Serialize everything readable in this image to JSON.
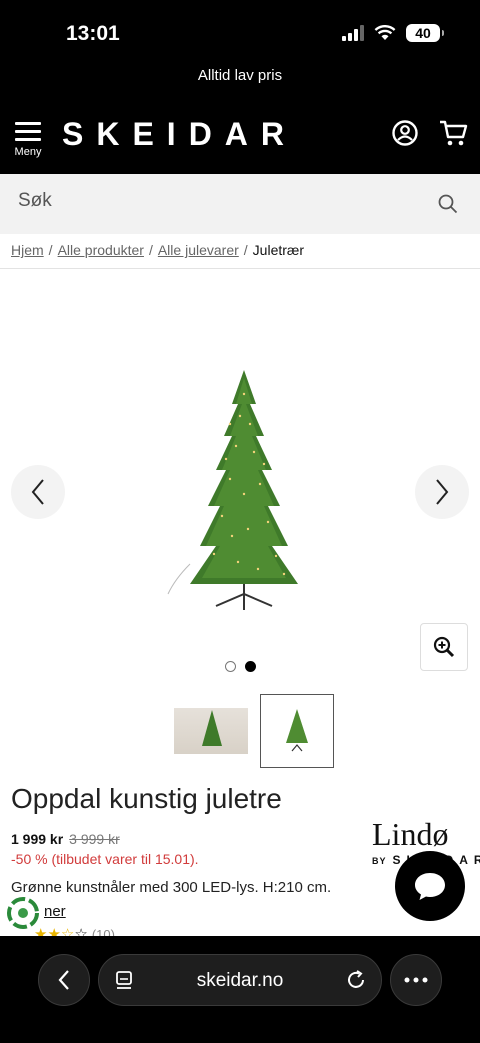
{
  "status": {
    "time": "13:01",
    "battery": "40"
  },
  "promo": {
    "text": "Alltid lav pris"
  },
  "header": {
    "logo": "SKEIDAR",
    "menu_label": "Meny"
  },
  "search": {
    "placeholder": "Søk"
  },
  "breadcrumb": {
    "items": [
      "Hjem",
      "Alle produkter",
      "Alle julevarer"
    ],
    "current": "Juletrær"
  },
  "gallery": {
    "slide_count": 2,
    "active_slide": 2
  },
  "product": {
    "title": "Oppdal kunstig juletre",
    "price_now": "1 999 kr",
    "price_old": "3 999 kr",
    "discount": "-50 % (tilbudet varer til 15.01).",
    "description": "Grønne kunstnåler med 300 LED-lys. H:210 cm.",
    "reco_link": "ner",
    "rating_stars": 3,
    "rating_count": "(10)"
  },
  "brand": {
    "name": "Lindø",
    "by": "BY",
    "parent": "SKEIDAR"
  },
  "browser": {
    "url": "skeidar.no"
  },
  "colors": {
    "header_bg": "#000000",
    "discount_red": "#d13b3b",
    "star": "#e8b400",
    "search_bg": "#f2f2f2"
  }
}
